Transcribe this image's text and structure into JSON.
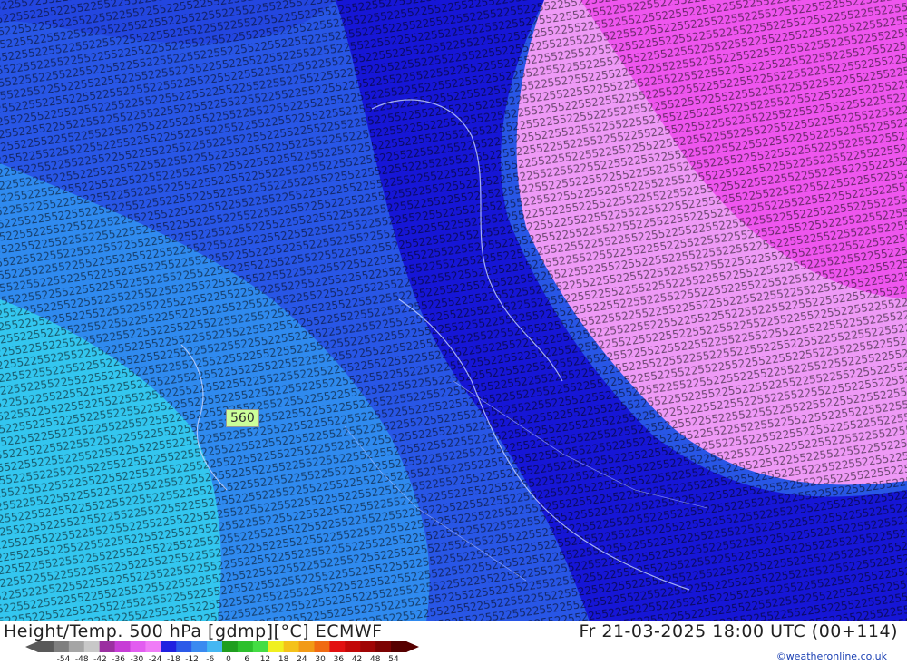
{
  "map": {
    "contour_label": "560",
    "regions": [
      {
        "name": "cold",
        "color": "#33c6ef"
      },
      {
        "name": "cool",
        "color": "#2f8aef"
      },
      {
        "name": "mid",
        "color": "#2856e6"
      },
      {
        "name": "band",
        "color": "#1616d6"
      },
      {
        "name": "warm",
        "color": "#ee99f6"
      },
      {
        "name": "warmer",
        "color": "#ee55ee"
      }
    ]
  },
  "footer": {
    "title": "Height/Temp. 500 hPa [gdmp][°C] ECMWF",
    "datetime": "Fr 21-03-2025 18:00 UTC (00+114)",
    "credit": "©weatheronline.co.uk"
  },
  "legend": {
    "ticks": [
      "-54",
      "-48",
      "-42",
      "-36",
      "-30",
      "-24",
      "-18",
      "-12",
      "-6",
      "0",
      "6",
      "12",
      "18",
      "24",
      "30",
      "36",
      "42",
      "48",
      "54"
    ],
    "colors": [
      "#595959",
      "#7f7f7f",
      "#a5a5a5",
      "#c8c8c8",
      "#9b30a0",
      "#c73dd6",
      "#e25df0",
      "#f07cf7",
      "#2020e0",
      "#2c5ae8",
      "#3a8af0",
      "#44b7f2",
      "#1f9e1f",
      "#2cc02c",
      "#44dd44",
      "#f0f020",
      "#f4c21a",
      "#f29a16",
      "#f06a12",
      "#e21010",
      "#c20808",
      "#a00404",
      "#7c0202",
      "#560000"
    ]
  }
}
